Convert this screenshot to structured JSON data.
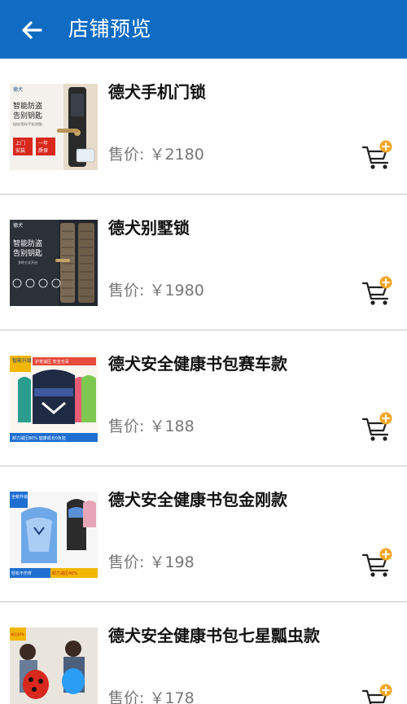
{
  "header": {
    "title": "店铺预览",
    "bg_color": "#0f6cc2"
  },
  "products": [
    {
      "name": "德犬手机门锁",
      "price_label": "售价:",
      "price": "￥2180",
      "thumb_icon": "smart-door-lock-image",
      "thumb_text": {
        "brand": "德犬",
        "line1": "智能防盗",
        "line2": "告别钥匙",
        "tag1": "上门安装",
        "tag2": "一年质保",
        "small": "指纹/密码/手机/钥匙"
      }
    },
    {
      "name": "德犬别墅锁",
      "price_label": "售价:",
      "price": "￥1980",
      "thumb_icon": "villa-lock-image",
      "thumb_text": {
        "brand": "德犬",
        "line1": "智能防盗",
        "line2": "告别钥匙",
        "small": "多种方式开启"
      }
    },
    {
      "name": "德犬安全健康书包赛车款",
      "price_label": "售价:",
      "price": "￥188",
      "thumb_icon": "racing-schoolbag-image",
      "thumb_text": {
        "badge": "智能升级",
        "top": "护脊减压 安全无毒",
        "bottom": "卸力减压80% 健康成长0负担"
      }
    },
    {
      "name": "德犬安全健康书包金刚款",
      "price_label": "售价:",
      "price": "￥198",
      "thumb_icon": "kingkong-schoolbag-image",
      "thumb_text": {
        "badge": "全新升级",
        "bottom1": "轻松不伤脊",
        "bottom2": "卸力减压40%"
      }
    },
    {
      "name": "德犬安全健康书包七星瓢虫款",
      "price_label": "售价:",
      "price": "￥178",
      "thumb_icon": "ladybug-schoolbag-image",
      "thumb_text": {
        "badge": "减压40%"
      }
    }
  ],
  "colors": {
    "accent": "#0f6cc2",
    "cart_badge": "#f5a623",
    "divider": "#c8c8c8",
    "price_text": "#777777"
  }
}
